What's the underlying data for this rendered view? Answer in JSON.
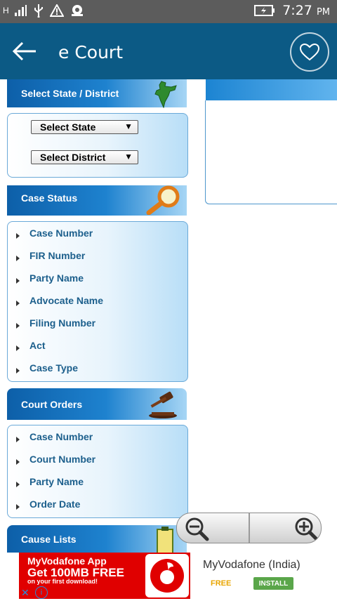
{
  "status_bar": {
    "network": "H",
    "time": "7:27",
    "ampm": "PM",
    "icons": [
      "signal-icon",
      "usb-icon",
      "warning-icon",
      "notification-icon",
      "battery-charging-icon"
    ]
  },
  "app_bar": {
    "title": "e Court"
  },
  "select_section": {
    "title": "Select State / District",
    "state_select": "Select State",
    "district_select": "Select District"
  },
  "case_status": {
    "title": "Case Status",
    "items": [
      "Case Number",
      "FIR Number",
      "Party Name",
      "Advocate Name",
      "Filing Number",
      "Act",
      "Case Type"
    ]
  },
  "court_orders": {
    "title": "Court Orders",
    "items": [
      "Case Number",
      "Court Number",
      "Party Name",
      "Order Date"
    ]
  },
  "cause_lists": {
    "title": "Cause Lists"
  },
  "ad": {
    "image_line1": "MyVodafone App",
    "image_line2": "Get 100MB FREE",
    "image_line3": "on your first download!",
    "title": "MyVodafone (India)",
    "price": "FREE",
    "install": "INSTALL"
  },
  "colors": {
    "status_bar": "#5c5c5c",
    "app_bar": "#0c5a85",
    "section_header": "#0d5fa8",
    "item_text": "#1c5f8c",
    "ad_red": "#e00000",
    "install_green": "#5aa64a"
  }
}
